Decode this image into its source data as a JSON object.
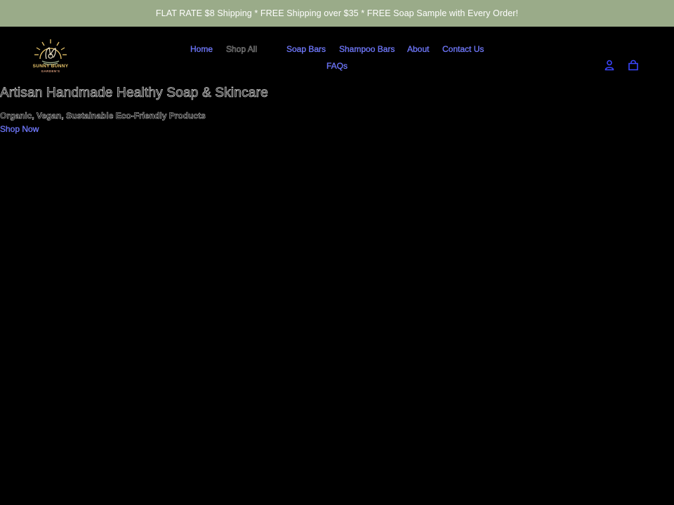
{
  "announcement": {
    "text": "FLAT RATE $8 Shipping * FREE Shipping over $35 * FREE Soap Sample with Every Order!",
    "background": "#9aab89"
  },
  "logo": {
    "line1": "SUNNY BUNNY",
    "line2": "GARDEN'S"
  },
  "nav": {
    "home": "Home",
    "shop_all": "Shop All",
    "soap_bars": "Soap Bars",
    "shampoo_bars": "Shampoo Bars",
    "about": "About",
    "contact_us": "Contact Us",
    "faqs": "FAQs"
  },
  "icons": {
    "account": "account-icon",
    "cart": "cart-icon"
  },
  "hero": {
    "title": "Artisan Handmade Healthy Soap & Skincare",
    "subtitle": "Organic, Vegan, Sustainable Eco-Friendly Products",
    "cta": "Shop Now"
  },
  "colors": {
    "link": "#5b66ff",
    "page_background": "#000000"
  }
}
